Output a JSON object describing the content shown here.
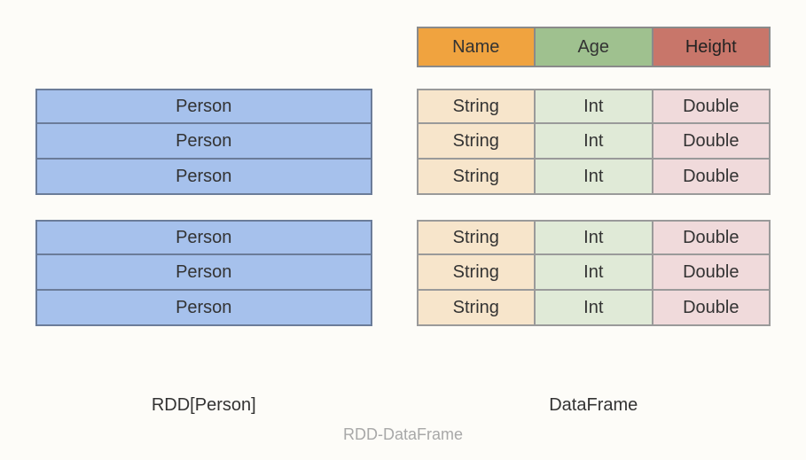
{
  "left": {
    "row_label": "Person",
    "caption": "RDD[Person]",
    "blocks": [
      3,
      3
    ]
  },
  "right": {
    "headers": {
      "name": "Name",
      "age": "Age",
      "height": "Height"
    },
    "types": {
      "name": "String",
      "age": "Int",
      "height": "Double"
    },
    "caption": "DataFrame",
    "blocks": [
      3,
      3
    ]
  },
  "footer": "RDD-DataFrame"
}
